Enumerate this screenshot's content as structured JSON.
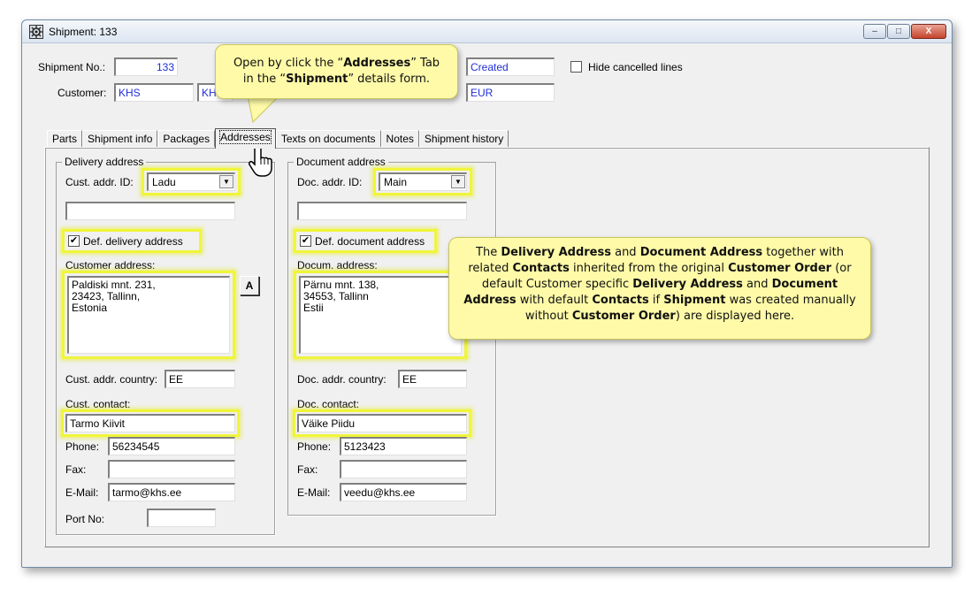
{
  "window": {
    "title": "Shipment: 133",
    "min": "–",
    "max": "□",
    "close": "X"
  },
  "header": {
    "shipment_no_label": "Shipment No.:",
    "shipment_no": "133",
    "customer_label": "Customer:",
    "customer_code": "KHS",
    "customer_name": "KH",
    "status": "Created",
    "currency": "EUR",
    "hide_cancelled_label": "Hide cancelled lines"
  },
  "tabs": [
    {
      "label": "Parts"
    },
    {
      "label": "Shipment info"
    },
    {
      "label": "Packages"
    },
    {
      "label": "Addresses"
    },
    {
      "label": "Texts on documents"
    },
    {
      "label": "Notes"
    },
    {
      "label": "Shipment history"
    }
  ],
  "delivery": {
    "group_title": "Delivery address",
    "addr_id_label": "Cust. addr. ID:",
    "addr_id": "Ladu",
    "extra": "",
    "default_label": "Def. delivery address",
    "default_checked": "✔",
    "address_label": "Customer address:",
    "address": "Paldiski mnt. 231,\n23423, Tallinn,\nEstonia",
    "a_button": "A",
    "country_label": "Cust. addr. country:",
    "country": "EE",
    "contact_label": "Cust. contact:",
    "contact": "Tarmo Kiivit",
    "phone_label": "Phone:",
    "phone": "56234545",
    "fax_label": "Fax:",
    "fax": "",
    "email_label": "E-Mail:",
    "email": "tarmo@khs.ee",
    "port_label": "Port No:",
    "port": ""
  },
  "document": {
    "group_title": "Document address",
    "addr_id_label": "Doc. addr. ID:",
    "addr_id": "Main",
    "extra": "",
    "default_label": "Def. document address",
    "default_checked": "✔",
    "address_label": "Docum. address:",
    "address": "Pärnu mnt. 138,\n34553, Tallinn\nEstii",
    "country_label": "Doc. addr. country:",
    "country": "EE",
    "contact_label": "Doc. contact:",
    "contact": "Väike Piidu",
    "phone_label": "Phone:",
    "phone": "5123423",
    "fax_label": "Fax:",
    "fax": "",
    "email_label": "E-Mail:",
    "email": "veedu@khs.ee"
  },
  "callout_top": {
    "t1": "Open by click the “",
    "b1": "Addresses",
    "t2": "” Tab",
    "t3": "in the “",
    "b2": "Shipment",
    "t4": "” details form."
  },
  "callout_right": {
    "t1": "The ",
    "b1": "Delivery Address",
    "t2": " and ",
    "b2": "Document Address",
    "t3": " together with related ",
    "b3": "Contacts",
    "t4": " inherited from the original ",
    "b4": "Customer Order",
    "t5": " (or default Customer specific ",
    "b5": "Delivery Address",
    "t6": " and ",
    "b6": "Document Address",
    "t7": " with default ",
    "b7": "Contacts",
    "t8": " if ",
    "b8": "Shipment",
    "t9": " was created manually without ",
    "b9": "Customer Order",
    "t10": ") are displayed here."
  },
  "colors": {
    "highlight": "#f0f53a",
    "callout_bg": "#fefaa8",
    "value_blue": "#1f2fd6"
  }
}
